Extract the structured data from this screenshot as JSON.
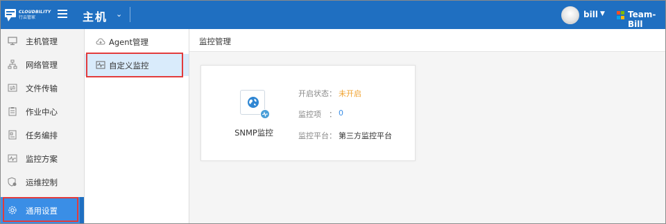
{
  "logo": {
    "brand": "CLOUDBILITY",
    "sub": "行云管家"
  },
  "header": {
    "title": "主机",
    "user": "bill",
    "team": "Team-Bill",
    "team_colors": [
      "#f25022",
      "#7fba00",
      "#00a4ef",
      "#ffb900"
    ]
  },
  "nav": {
    "items": [
      {
        "label": "主机管理",
        "icon": "monitor-icon"
      },
      {
        "label": "网络管理",
        "icon": "network-icon"
      },
      {
        "label": "文件传输",
        "icon": "file-transfer-icon"
      },
      {
        "label": "作业中心",
        "icon": "clipboard-icon"
      },
      {
        "label": "任务编排",
        "icon": "task-orchestration-icon"
      },
      {
        "label": "监控方案",
        "icon": "monitor-chart-icon"
      },
      {
        "label": "运维控制",
        "icon": "shield-gear-icon"
      },
      {
        "label": "通用设置",
        "icon": "settings-gear-icon",
        "active": true
      }
    ]
  },
  "subnav": {
    "items": [
      {
        "label": "Agent管理",
        "icon": "cloud-icon"
      },
      {
        "label": "自定义监控",
        "icon": "pulse-monitor-icon",
        "active": true
      }
    ]
  },
  "main": {
    "breadcrumb": "监控管理",
    "card": {
      "name": "SNMP监控",
      "icon": "globe-icon",
      "fields": [
        {
          "label": "开启状态：",
          "value": "未开启"
        },
        {
          "label": "监控项",
          "sep": "：",
          "value": "0"
        },
        {
          "label": "监控平台：",
          "value": "第三方监控平台"
        }
      ]
    }
  },
  "colors": {
    "accent": "#1f6fc1",
    "active": "#3a8ee6",
    "warn": "#f0a330",
    "highlight": "#e23b3b"
  }
}
